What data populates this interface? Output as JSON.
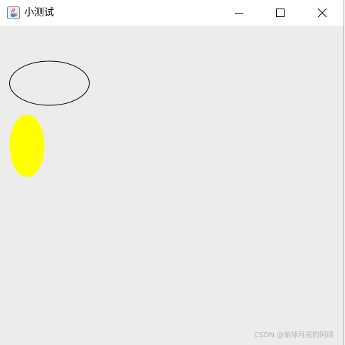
{
  "window": {
    "title": "小测试"
  },
  "icons": {
    "app": "java-coffee-cup-icon",
    "minimize": "minimize-icon",
    "maximize": "maximize-icon",
    "close": "close-icon"
  },
  "shapes": {
    "outline_ellipse": {
      "stroke": "#000000",
      "fill": "none"
    },
    "filled_ellipse": {
      "fill": "#ffff00"
    }
  },
  "colors": {
    "client_background": "#ececec",
    "titlebar_background": "#ffffff"
  },
  "watermark": "CSDN @偷掉月亮的阿硕"
}
